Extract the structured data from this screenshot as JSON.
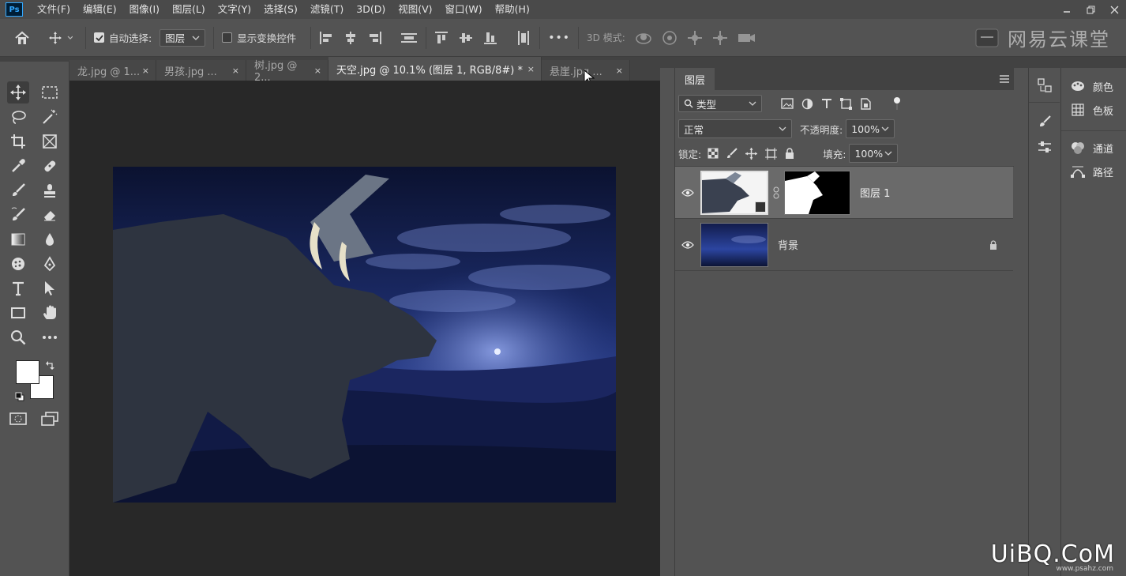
{
  "menu": {
    "logo": "Ps",
    "items": [
      "文件(F)",
      "编辑(E)",
      "图像(I)",
      "图层(L)",
      "文字(Y)",
      "选择(S)",
      "滤镜(T)",
      "3D(D)",
      "视图(V)",
      "窗口(W)",
      "帮助(H)"
    ]
  },
  "options": {
    "auto_select_label": "自动选择:",
    "auto_select_value": "图层",
    "show_transform_label": "显示变换控件",
    "mode3d_label": "3D 模式:",
    "more": "•••"
  },
  "watermark": {
    "text": "网易云课堂"
  },
  "tabs": [
    {
      "label": "龙.jpg @ 1...",
      "close": "×"
    },
    {
      "label": "男孩.jpg ...",
      "close": "×"
    },
    {
      "label": "树.jpg @ 2...",
      "close": "×"
    },
    {
      "label": "天空.jpg @ 10.1% (图层 1, RGB/8#) *",
      "close": "×"
    },
    {
      "label": "悬崖.jpg ...",
      "close": "×"
    }
  ],
  "layers_panel": {
    "tab": "图层",
    "filter_value": "类型",
    "blend_mode": "正常",
    "opacity_label": "不透明度:",
    "opacity_value": "100%",
    "lock_label": "锁定:",
    "fill_label": "填充:",
    "fill_value": "100%",
    "layers": [
      {
        "name": "图层 1",
        "selected": true
      },
      {
        "name": "背景",
        "selected": false
      }
    ]
  },
  "dock": {
    "items": [
      {
        "label": "颜色",
        "icon": "palette-icon"
      },
      {
        "label": "色板",
        "icon": "grid-icon"
      },
      {
        "label": "通道",
        "icon": "channels-icon"
      },
      {
        "label": "路径",
        "icon": "paths-icon"
      }
    ]
  },
  "site_watermark": {
    "text": "UiBQ.CoM",
    "sub": "www.psahz.com"
  },
  "colors": {
    "accent": "#31a8ff",
    "panel": "#535353",
    "dark": "#424242",
    "canvas": "#282828"
  }
}
